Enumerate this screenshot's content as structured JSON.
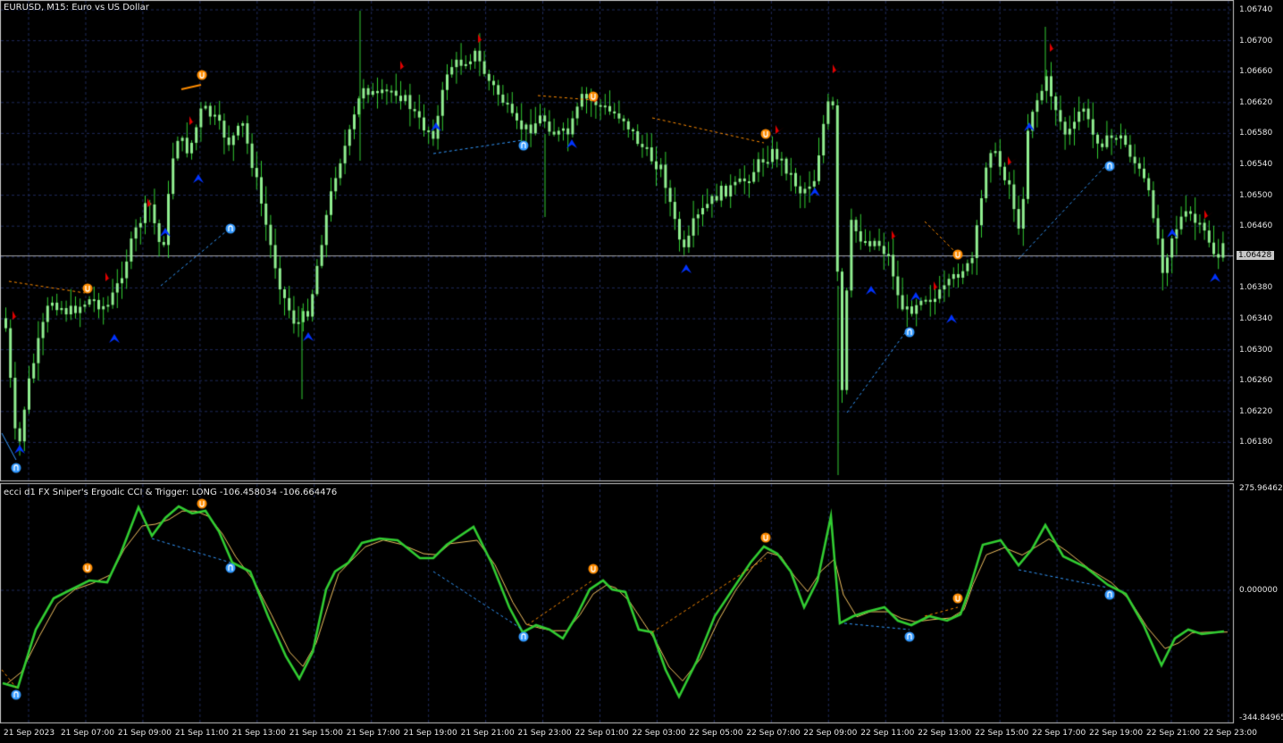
{
  "main_title": "EURUSD, M15:  Euro vs US Dollar",
  "sub_title": "ecci d1 FX Sniper's Ergodic CCI & Trigger: LONG  -106.458034 -106.664476",
  "price_axis": [
    "1.06740",
    "1.06700",
    "1.06660",
    "1.06620",
    "1.06580",
    "1.06540",
    "1.06500",
    "1.06460",
    "1.06420",
    "1.06380",
    "1.06340",
    "1.06300",
    "1.06260",
    "1.06220",
    "1.06180"
  ],
  "current_price": "1.06428",
  "indicator_axis": {
    "top": "275.964624",
    "zero": "0.000000",
    "bottom": "-344.84965"
  },
  "time_axis": [
    "21 Sep 2023",
    "21 Sep 07:00",
    "21 Sep 09:00",
    "21 Sep 11:00",
    "21 Sep 13:00",
    "21 Sep 15:00",
    "21 Sep 17:00",
    "21 Sep 19:00",
    "21 Sep 21:00",
    "21 Sep 23:00",
    "22 Sep 01:00",
    "22 Sep 03:00",
    "22 Sep 05:00",
    "22 Sep 07:00",
    "22 Sep 09:00",
    "22 Sep 11:00",
    "22 Sep 13:00",
    "22 Sep 15:00",
    "22 Sep 17:00",
    "22 Sep 19:00",
    "22 Sep 21:00",
    "22 Sep 23:00"
  ],
  "colors": {
    "background": "#000000",
    "candle": "#90ee90",
    "wick": "#32cd32",
    "grid": "#1f2a5a",
    "cci": "#32cd32",
    "trigger": "#f0c060",
    "sell_arrow": "#e00000",
    "buy_arrow": "#0033ff",
    "bullish_divergence": "#3399ff",
    "bearish_divergence": "#ff8c00"
  }
}
